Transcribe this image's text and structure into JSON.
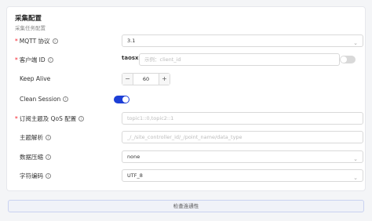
{
  "section": {
    "title": "采集配置",
    "subtitle": "采集任务配置"
  },
  "fields": {
    "mqtt_version": {
      "label": "MQTT 协议",
      "value": "3.1"
    },
    "client_id": {
      "label": "客户端 ID",
      "prefix": "taosx",
      "placeholder": "示例：client_id",
      "toggle": "off"
    },
    "keep_alive": {
      "label": "Keep Alive",
      "value": "60",
      "minus": "−",
      "plus": "+"
    },
    "clean_session": {
      "label": "Clean Session",
      "toggle": "on"
    },
    "topics": {
      "label": "订阅主题及 QoS 配置",
      "placeholder": "topic1::0,topic2::1"
    },
    "topic_parse": {
      "label": "主题解析",
      "placeholder": "_/_/site_controller_id/_/point_name/data_type"
    },
    "compression": {
      "label": "数据压缩",
      "value": "none"
    },
    "encoding": {
      "label": "字符编码",
      "value": "UTF_8"
    }
  },
  "actions": {
    "check_connectivity": "检查连通性"
  },
  "colors": {
    "accent": "#1d3fd6",
    "required": "#f5222d"
  },
  "icons": {
    "info": "info-circle-icon",
    "chevron": "chevron-down-icon"
  }
}
